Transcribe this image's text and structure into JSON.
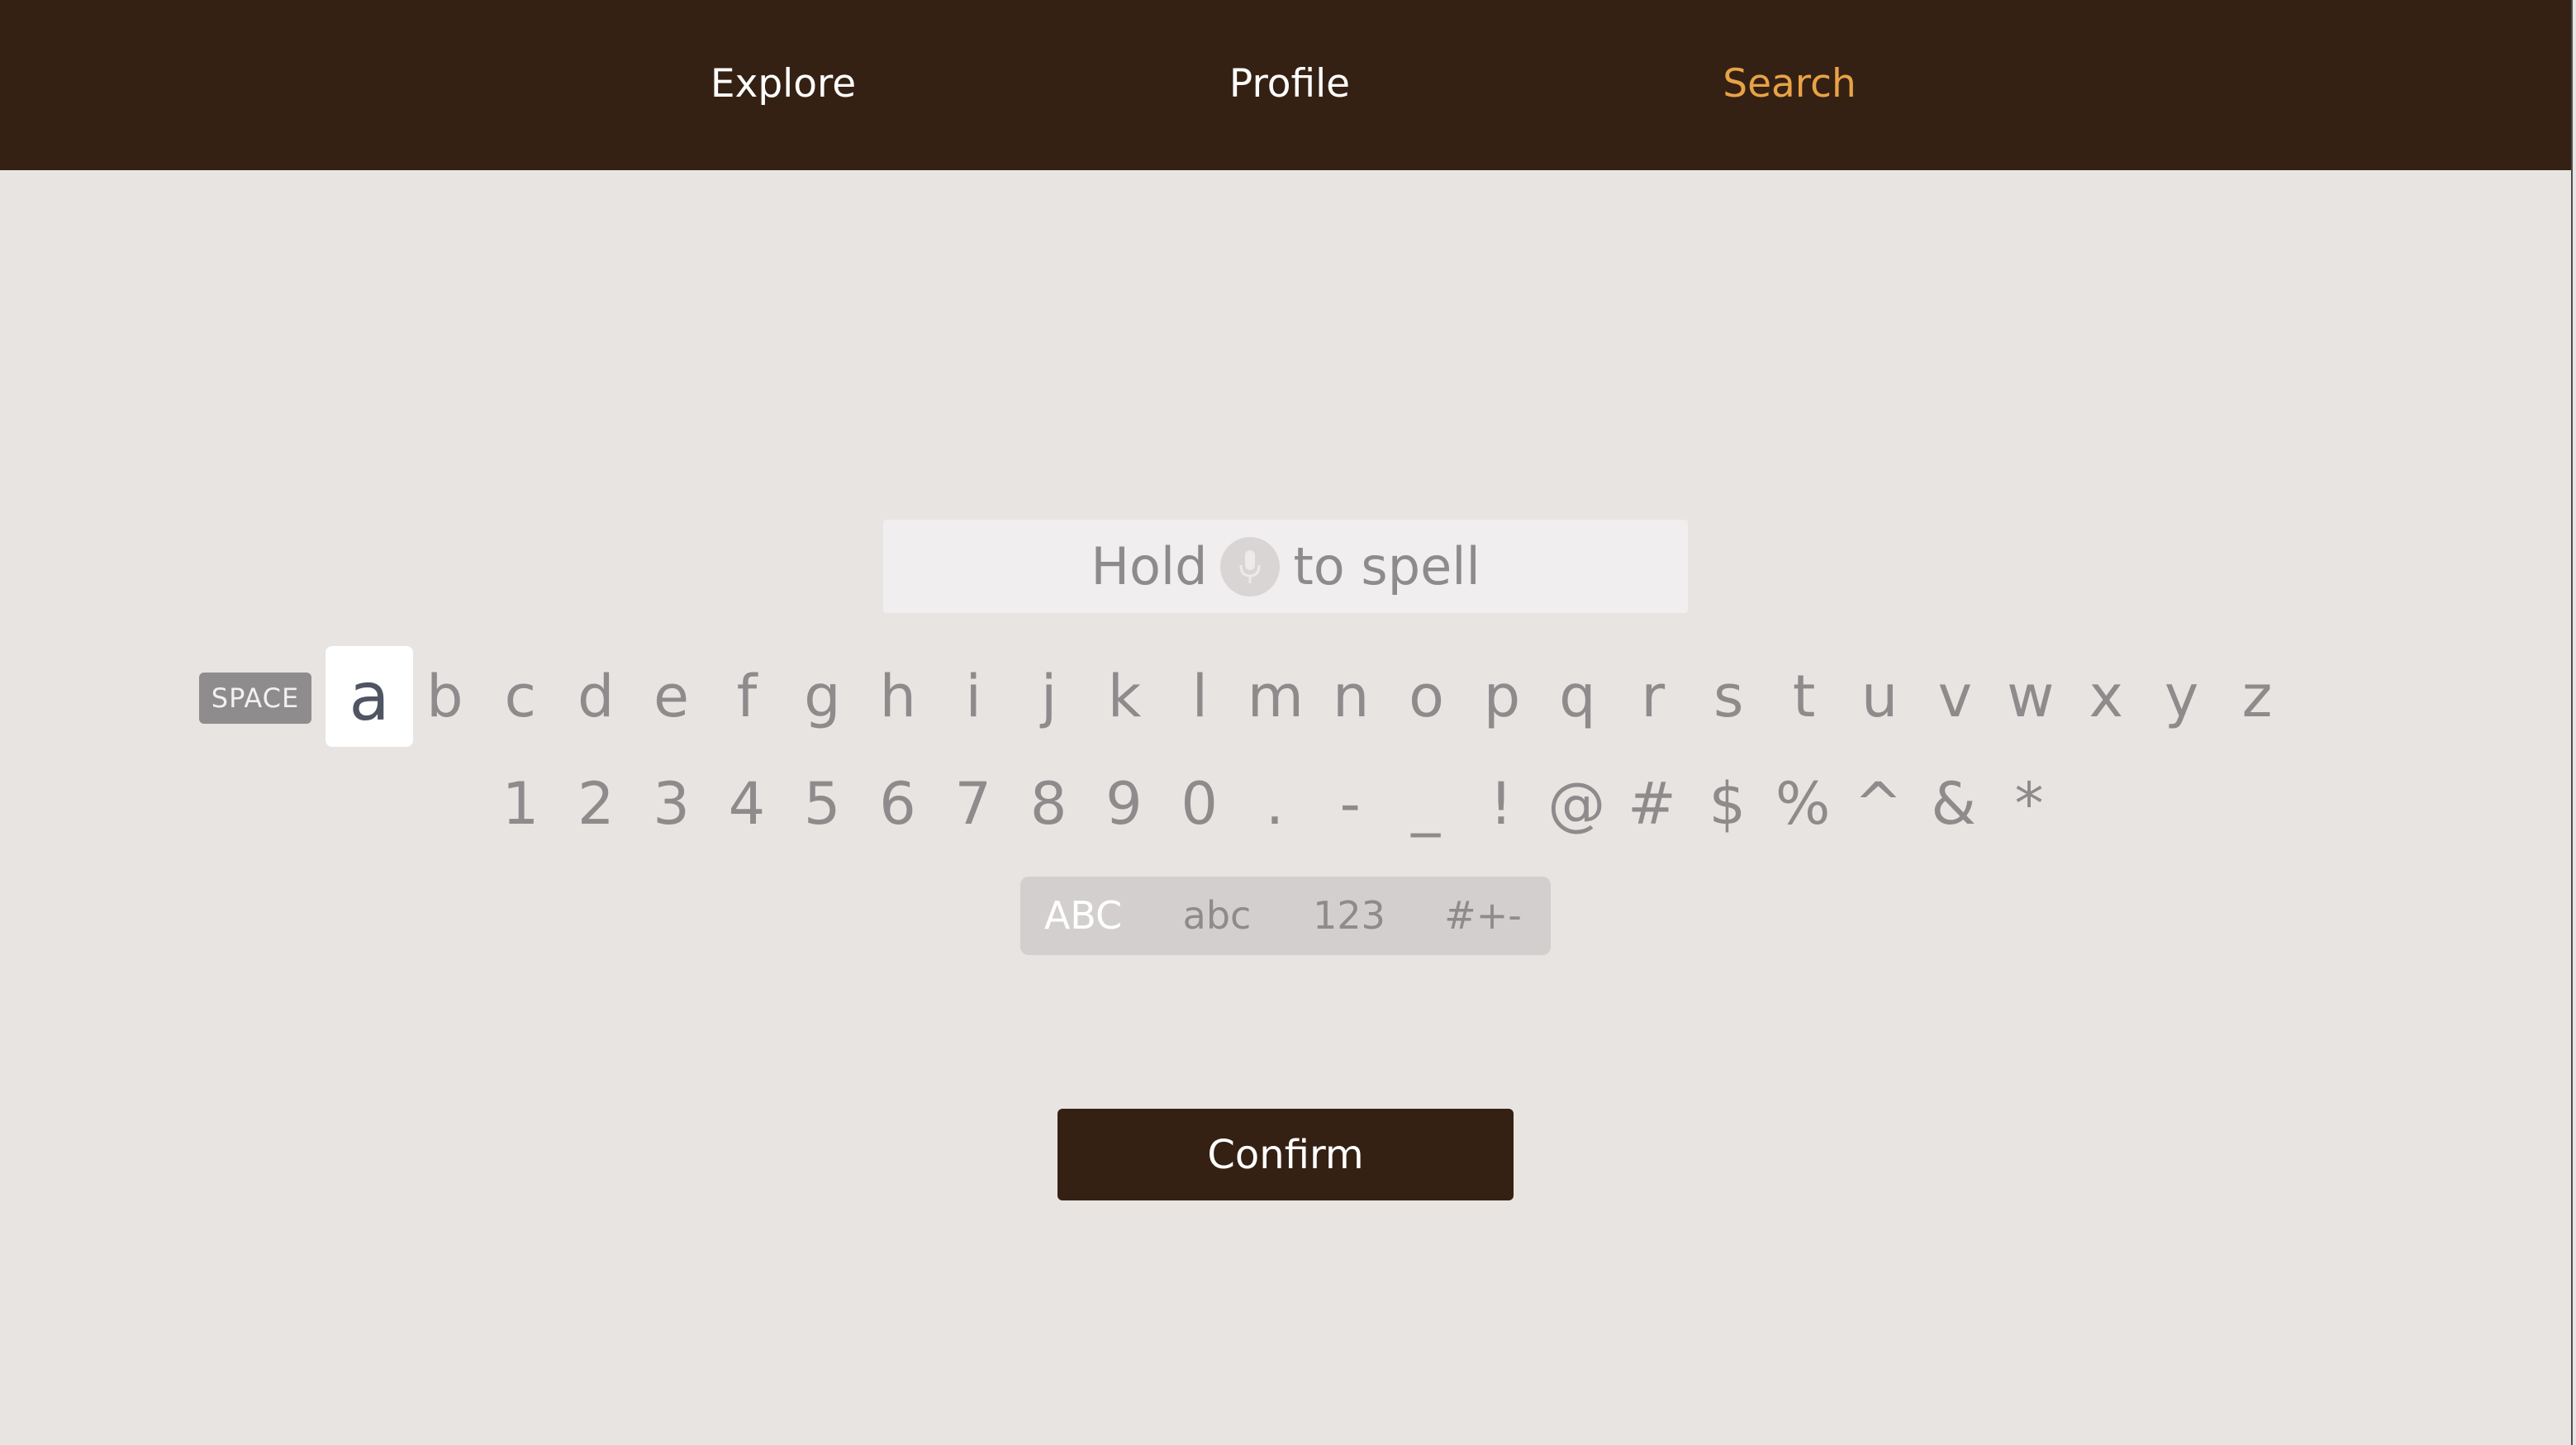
{
  "nav": {
    "items": [
      {
        "label": "Explore"
      },
      {
        "label": "Profile"
      },
      {
        "label": "Search"
      }
    ],
    "active": "Search",
    "active_color": "#e8a347"
  },
  "search": {
    "hint_before": "Hold",
    "hint_after": "to spell",
    "mic_icon": "microphone-icon"
  },
  "keyboard": {
    "space_label": "SPACE",
    "focused_key": "a",
    "letters": [
      "a",
      "b",
      "c",
      "d",
      "e",
      "f",
      "g",
      "h",
      "i",
      "j",
      "k",
      "l",
      "m",
      "n",
      "o",
      "p",
      "q",
      "r",
      "s",
      "t",
      "u",
      "v",
      "w",
      "x",
      "y",
      "z"
    ],
    "symbols": [
      "1",
      "2",
      "3",
      "4",
      "5",
      "6",
      "7",
      "8",
      "9",
      "0",
      ".",
      "-",
      "_",
      "!",
      "@",
      "#",
      "$",
      "%",
      "^",
      "&",
      "*"
    ],
    "modes": [
      {
        "label": "ABC"
      },
      {
        "label": "abc"
      },
      {
        "label": "123"
      },
      {
        "label": "#+-"
      }
    ],
    "selected_mode": "ABC"
  },
  "confirm": {
    "label": "Confirm"
  },
  "colors": {
    "bar": "#352113",
    "background": "#e8e4e2",
    "key_text": "#8d8b8b"
  }
}
